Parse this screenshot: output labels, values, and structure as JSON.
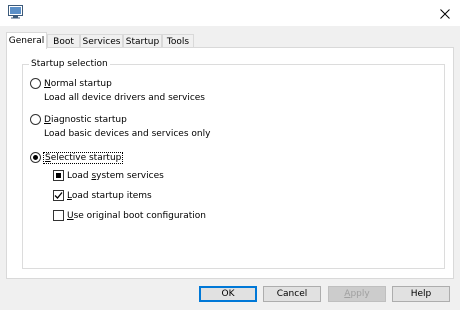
{
  "window": {
    "icon": "msconfig-app-icon",
    "close_icon": "close-icon"
  },
  "tabs": [
    {
      "label": "General",
      "active": true
    },
    {
      "label": "Boot",
      "active": false
    },
    {
      "label": "Services",
      "active": false
    },
    {
      "label": "Startup",
      "active": false
    },
    {
      "label": "Tools",
      "active": false
    }
  ],
  "startup_selection": {
    "group_label": "Startup selection",
    "options": [
      {
        "label": "Normal startup",
        "mnemonic": "N",
        "rest": "ormal startup",
        "description": "Load all device drivers and services",
        "selected": false
      },
      {
        "label": "Diagnostic startup",
        "mnemonic": "D",
        "rest": "iagnostic startup",
        "description": "Load basic devices and services only",
        "selected": false
      },
      {
        "label": "Selective startup",
        "mnemonic": "S",
        "rest": "elective startup",
        "description": "",
        "selected": true
      }
    ],
    "selective_items": [
      {
        "label": "Load system services",
        "mnemonic": "s",
        "prefix": "Load ",
        "rest": "ystem services",
        "state": "indeterminate"
      },
      {
        "label": "Load startup items",
        "mnemonic": "L",
        "prefix": "",
        "rest": "oad startup items",
        "state": "checked"
      },
      {
        "label": "Use original boot configuration",
        "mnemonic": "U",
        "prefix": "",
        "rest": "se original boot configuration",
        "state": "unchecked"
      }
    ]
  },
  "buttons": {
    "ok": "OK",
    "cancel": "Cancel",
    "apply_mnemonic": "A",
    "apply_rest": "pply",
    "help": "Help"
  },
  "colors": {
    "accent": "#0078d7",
    "window_bg": "#f0f0f0",
    "panel_bg": "#ffffff"
  }
}
